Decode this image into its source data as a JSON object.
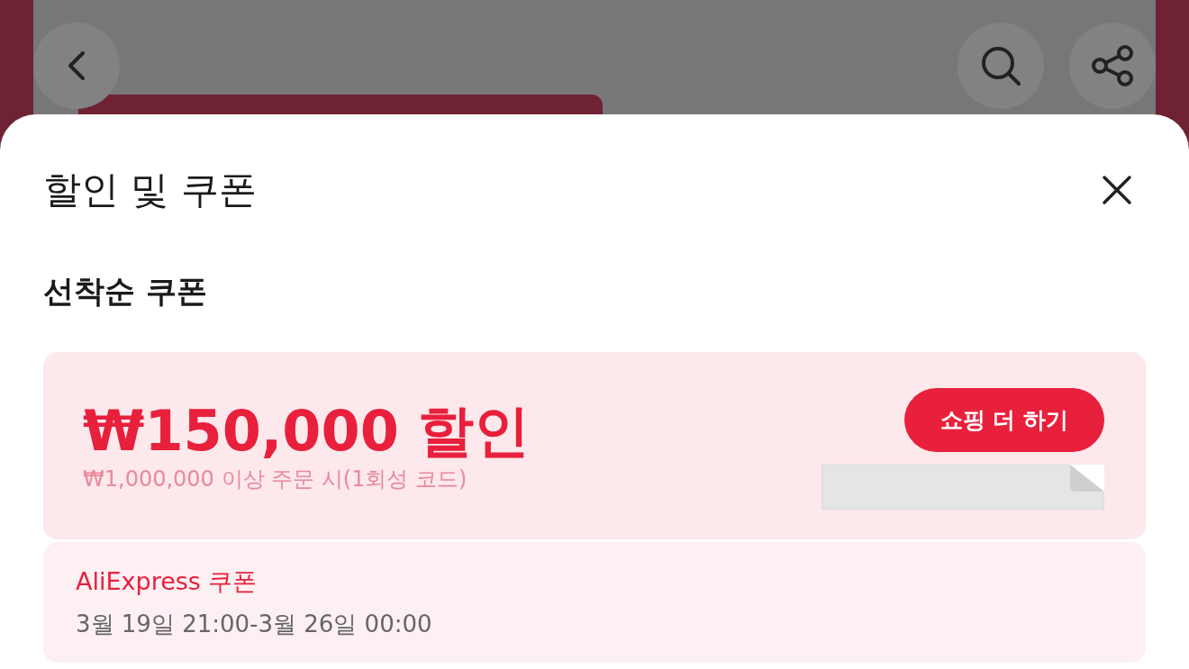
{
  "sheet": {
    "title": "할인 및 쿠폰",
    "section_title": "선착순 쿠폰"
  },
  "coupon": {
    "amount": "₩150,000 할인",
    "condition": "₩1,000,000 이상 주문 시(1회성 코드)",
    "button": "쇼핑 더 하기",
    "issuer": "AliExpress 쿠폰",
    "period": "3월 19일 21:00-3월 26일 00:00"
  }
}
